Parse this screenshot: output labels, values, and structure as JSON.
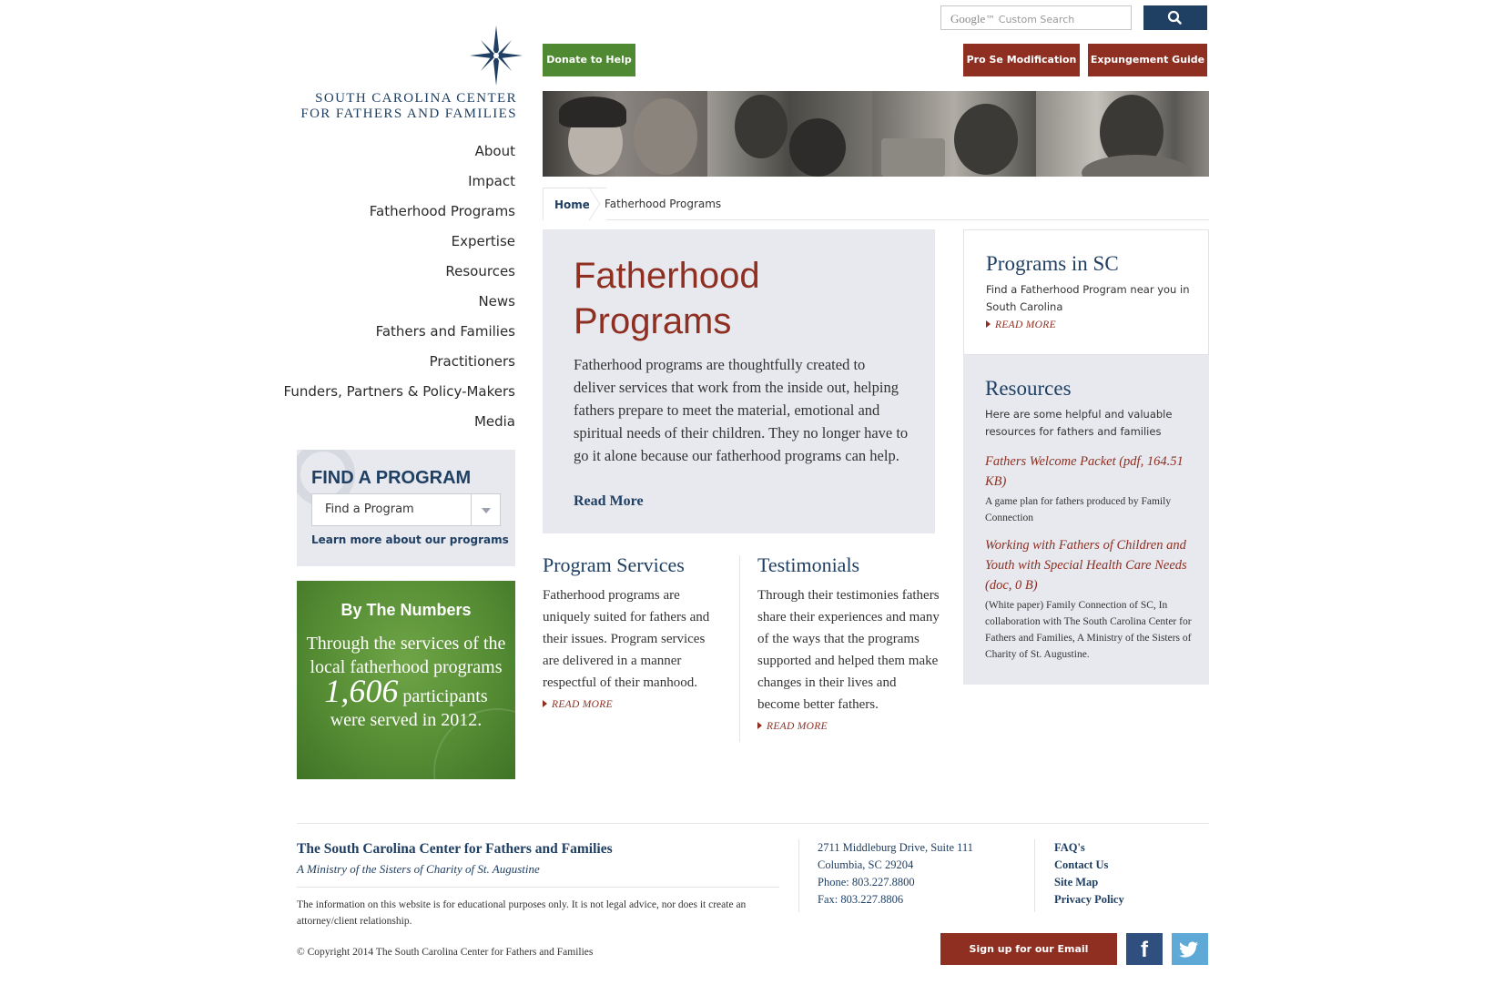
{
  "logo": {
    "line1": "SOUTH CAROLINA CENTER",
    "line2": "FOR FATHERS AND FAMILIES"
  },
  "nav": [
    {
      "label": "About"
    },
    {
      "label": "Impact"
    },
    {
      "label": "Fatherhood Programs"
    },
    {
      "label": "Expertise"
    },
    {
      "label": "Resources"
    },
    {
      "label": "News"
    },
    {
      "label": "Fathers and Families"
    },
    {
      "label": "Practitioners"
    },
    {
      "label": "Funders, Partners & Policy-Makers"
    },
    {
      "label": "Media"
    }
  ],
  "find_program": {
    "title": "FIND A PROGRAM",
    "select_value": "Find a Program",
    "link": "Learn more about our programs"
  },
  "numbers": {
    "title": "By The Numbers",
    "text_before": "Through the services of the local fatherhood programs",
    "figure": "1,606",
    "text_after": "participants were served in 2012."
  },
  "search": {
    "google": "Google",
    "placeholder": "Custom Search",
    "icon": "search-icon"
  },
  "top_buttons": {
    "donate": "Donate to Help",
    "prose": "Pro Se Modification",
    "expunge": "Expungement Guide"
  },
  "breadcrumb": {
    "home": "Home",
    "current": "Fatherhood Programs"
  },
  "hero": {
    "title": "Fatherhood Programs",
    "body": "Fatherhood programs are thoughtfully created to deliver services that work from the inside out, helping fathers prepare to meet the material, emotional and spiritual needs of their children. They no longer have to go it alone because our fatherhood programs can help.",
    "more": "Read More"
  },
  "columns": [
    {
      "title": "Program Services",
      "body": "Fatherhood programs are uniquely suited for fathers and their issues. Program services are delivered in a manner respectful of their manhood.",
      "more": "READ MORE"
    },
    {
      "title": "Testimonials",
      "body": "Through their testimonies fathers share their experiences and many of the ways that the programs supported and helped them make changes in their lives and become better fathers.",
      "more": "READ MORE"
    }
  ],
  "sidebar": {
    "programs": {
      "title": "Programs in SC",
      "body": "Find a Fatherhood Program near you in South Carolina",
      "more": "READ MORE"
    },
    "resources": {
      "title": "Resources",
      "body": "Here are some helpful and valuable resources for fathers and families",
      "items": [
        {
          "link": "Fathers Welcome Packet (pdf, 164.51 KB)",
          "desc": "A game plan for fathers produced by Family Connection"
        },
        {
          "link": "Working with Fathers of Children and Youth with Special Health Care Needs (doc, 0 B)",
          "desc": "(White paper) Family Connection of SC, In collaboration with The South Carolina Center for Fathers and Families, A Ministry of the Sisters of Charity of St. Augustine."
        }
      ]
    }
  },
  "footer": {
    "org": "The South Carolina Center for Fathers and Families",
    "ministry": "A Ministry of the Sisters of Charity of St. Augustine",
    "disclaimer": "The information on this website is for educational purposes only. It is not legal advice, nor does it create an attorney/client relationship.",
    "copyright": "© Copyright 2014 The South Carolina Center for Fathers and Families",
    "address": {
      "line1": "2711 Middleburg Drive, Suite 111",
      "line2": "Columbia, SC 29204",
      "phone": "Phone: 803.227.8800",
      "fax": "Fax: 803.227.8806"
    },
    "links": [
      "FAQ's",
      "Contact Us",
      "Site Map",
      "Privacy Policy"
    ],
    "newsletter": "Sign up for our Email Newsletter",
    "facebook": "f"
  },
  "colors": {
    "navy": "#1f3f63",
    "brick": "#8e2f22",
    "green": "#4f8a32",
    "panel": "#e7e9ee"
  }
}
